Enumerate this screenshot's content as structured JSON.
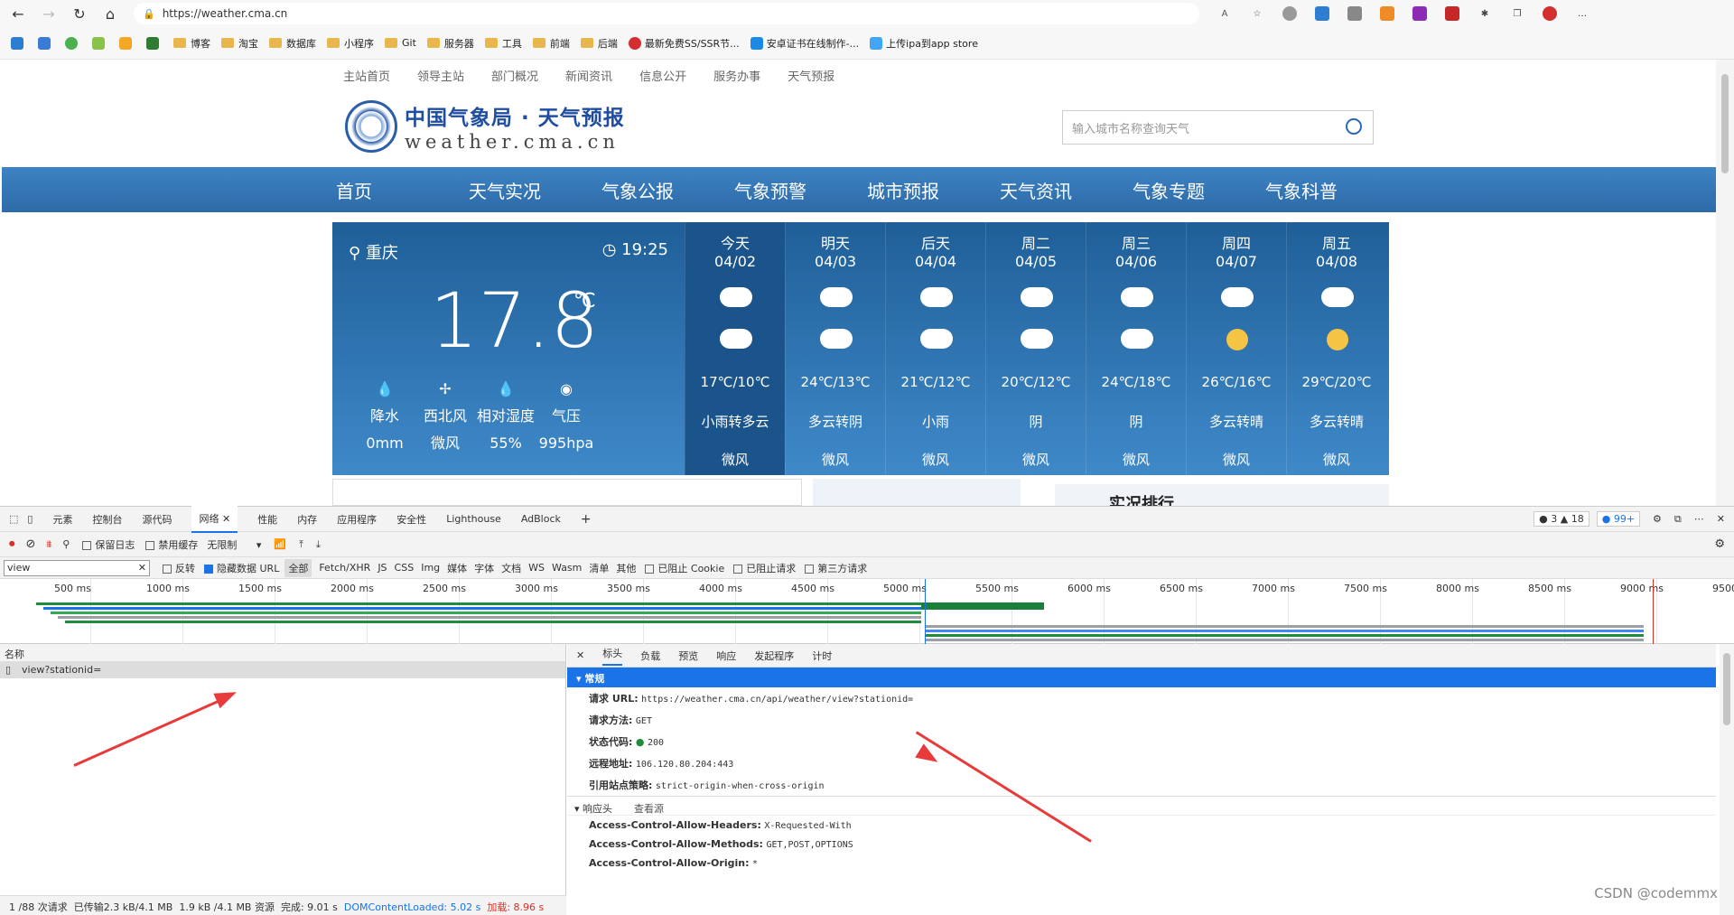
{
  "browser": {
    "url": "https://weather.cma.cn",
    "bookmarks": [
      "博客",
      "淘宝",
      "数据库",
      "小程序",
      "Git",
      "服务器",
      "工具",
      "前端",
      "后端",
      "最新免费SS/SSR节...",
      "安卓证书在线制作-...",
      "上传ipa到app store"
    ]
  },
  "site": {
    "topnav": [
      "主站首页",
      "领导主站",
      "部门概况",
      "新闻资讯",
      "信息公开",
      "服务办事",
      "天气预报"
    ],
    "logo_title": "中国气象局 · 天气预报",
    "logo_sub": "weather.cma.cn",
    "search_placeholder": "输入城市名称查询天气",
    "mainnav": [
      "首页",
      "天气实况",
      "气象公报",
      "气象预警",
      "城市预报",
      "天气资讯",
      "气象专题",
      "气象科普"
    ],
    "now": {
      "city": "重庆",
      "time": "19:25",
      "temp": "17.8",
      "unit": "℃",
      "info": [
        {
          "label": "降水",
          "value": "0mm"
        },
        {
          "label": "西北风",
          "value": "微风"
        },
        {
          "label": "相对湿度",
          "value": "55%"
        },
        {
          "label": "气压",
          "value": "995hpa"
        }
      ]
    },
    "days": [
      {
        "d1": "今天",
        "d2": "04/02",
        "t": "17℃/10℃",
        "w": "小雨转多云",
        "wd": "微风"
      },
      {
        "d1": "明天",
        "d2": "04/03",
        "t": "24℃/13℃",
        "w": "多云转阴",
        "wd": "微风"
      },
      {
        "d1": "后天",
        "d2": "04/04",
        "t": "21℃/12℃",
        "w": "小雨",
        "wd": "微风"
      },
      {
        "d1": "周二",
        "d2": "04/05",
        "t": "20℃/12℃",
        "w": "阴",
        "wd": "微风"
      },
      {
        "d1": "周三",
        "d2": "04/06",
        "t": "24℃/18℃",
        "w": "阴",
        "wd": "微风"
      },
      {
        "d1": "周四",
        "d2": "04/07",
        "t": "26℃/16℃",
        "w": "多云转晴",
        "wd": "微风"
      },
      {
        "d1": "周五",
        "d2": "04/08",
        "t": "29℃/20℃",
        "w": "多云转晴",
        "wd": "微风"
      }
    ],
    "ranking_title": "实况排行"
  },
  "devtools": {
    "tabs": [
      "元素",
      "控制台",
      "源代码",
      "网络",
      "性能",
      "内存",
      "应用程序",
      "安全性",
      "Lighthouse",
      "AdBlock"
    ],
    "badges": {
      "errors": "3",
      "warnings": "18",
      "info": "99+"
    },
    "toolbar": {
      "preserve_log": "保留日志",
      "disable_cache": "禁用缓存",
      "throttle": "无限制"
    },
    "filter": {
      "value": "view",
      "invert": "反转",
      "hide_data": "隐藏数据 URL",
      "types": [
        "全部",
        "Fetch/XHR",
        "JS",
        "CSS",
        "Img",
        "媒体",
        "字体",
        "文档",
        "WS",
        "Wasm",
        "清单",
        "其他"
      ],
      "blocked_cookie": "已阻止 Cookie",
      "blocked_req": "已阻止请求",
      "third_party": "第三方请求"
    },
    "ticks": [
      "500 ms",
      "1000 ms",
      "1500 ms",
      "2000 ms",
      "2500 ms",
      "3000 ms",
      "3500 ms",
      "4000 ms",
      "4500 ms",
      "5000 ms",
      "5500 ms",
      "6000 ms",
      "6500 ms",
      "7000 ms",
      "7500 ms",
      "8000 ms",
      "8500 ms",
      "9000 ms",
      "9500"
    ],
    "name_header": "名称",
    "request_name": "view?stationid=",
    "status": {
      "requests": "1 /88 次请求",
      "transferred": "已传输2.3 kB/4.1 MB",
      "resources": "1.9 kB /4.1 MB 资源",
      "finish": "完成: 9.01 s",
      "dcl": "DOMContentLoaded: 5.02 s",
      "load": "加载: 8.96 s"
    },
    "detail_tabs": [
      "标头",
      "负载",
      "预览",
      "响应",
      "发起程序",
      "计时"
    ],
    "general_title": "常规",
    "general": [
      {
        "k": "请求 URL:",
        "v": "https://weather.cma.cn/api/weather/view?stationid="
      },
      {
        "k": "请求方法:",
        "v": "GET"
      },
      {
        "k": "状态代码:",
        "v": "200"
      },
      {
        "k": "远程地址:",
        "v": "106.120.80.204:443"
      },
      {
        "k": "引用站点策略:",
        "v": "strict-origin-when-cross-origin"
      }
    ],
    "response_title": "响应头",
    "view_source": "查看源",
    "response": [
      {
        "k": "Access-Control-Allow-Headers:",
        "v": "X-Requested-With"
      },
      {
        "k": "Access-Control-Allow-Methods:",
        "v": "GET,POST,OPTIONS"
      },
      {
        "k": "Access-Control-Allow-Origin:",
        "v": "*"
      }
    ]
  },
  "watermark": "CSDN @codemmx"
}
